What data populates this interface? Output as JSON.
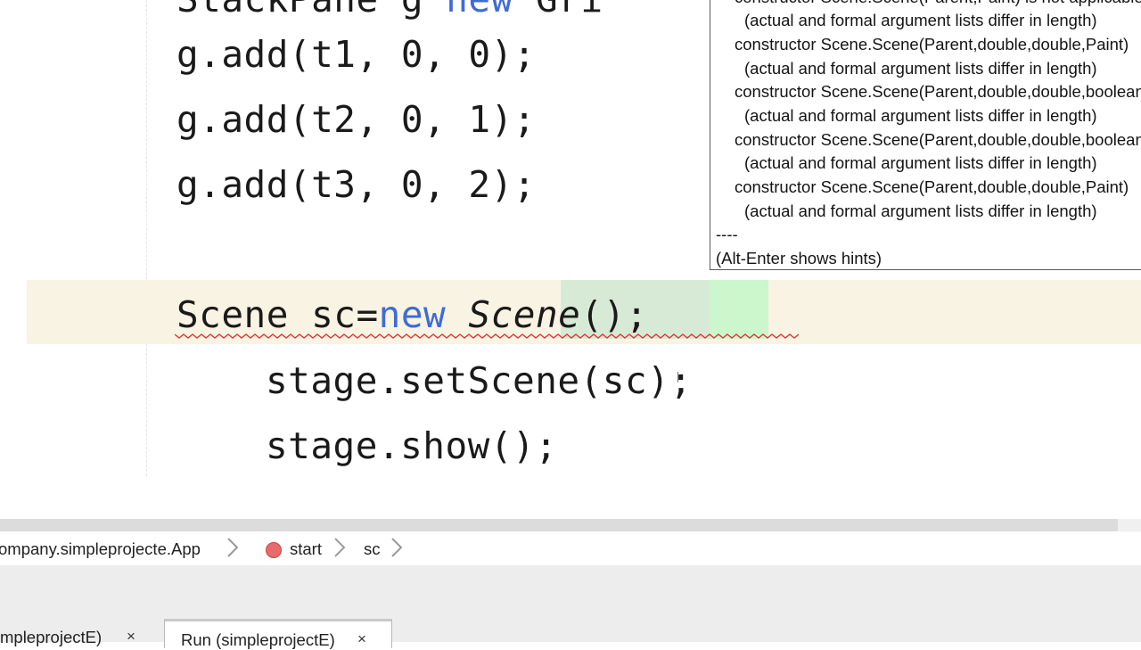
{
  "editor": {
    "lines": {
      "top_partial": {
        "left": "StackPane g ",
        "kw": "new",
        "right": " Gri"
      },
      "add1": "g.add(t1, 0, 0);",
      "add2": "g.add(t2, 0, 1);",
      "add3": "g.add(t3, 0, 2);",
      "scene": {
        "type": "Scene sc=",
        "kw": "new",
        "space": " ",
        "cls": "Scene",
        "parens": "()",
        "end": ";"
      },
      "set_scene": {
        "head": "stage.setScene",
        "tail": "(sc);"
      },
      "show": "stage.show();"
    }
  },
  "tooltip": {
    "lines": [
      "constructor Scene.Scene(Parent,Paint) is not applicable",
      "(actual and formal argument lists differ in length)",
      "constructor Scene.Scene(Parent,double,double,Paint)",
      "(actual and formal argument lists differ in length)",
      "constructor Scene.Scene(Parent,double,double,boolean)",
      "(actual and formal argument lists differ in length)",
      "constructor Scene.Scene(Parent,double,double,boolean,SceneAntialiasing)",
      "(actual and formal argument lists differ in length)",
      "constructor Scene.Scene(Parent,double,double,Paint)",
      "(actual and formal argument lists differ in length)"
    ],
    "separator": "----",
    "hint": "(Alt-Enter shows hints)"
  },
  "breadcrumb": {
    "class_crumb": "ompany.simpleprojecte.App",
    "method_crumb": "start",
    "var_crumb": "sc",
    "chevron": "›"
  },
  "output_tabs": [
    {
      "label": "mpleprojectE)",
      "close": "×"
    },
    {
      "label": "Run (simpleprojectE)",
      "close": "×"
    }
  ],
  "colors": {
    "keyword": "#3e6bd6",
    "current_line": "#f8f3e3",
    "error_squiggle": "#e03030",
    "match_highlight": "#d7ead6"
  }
}
